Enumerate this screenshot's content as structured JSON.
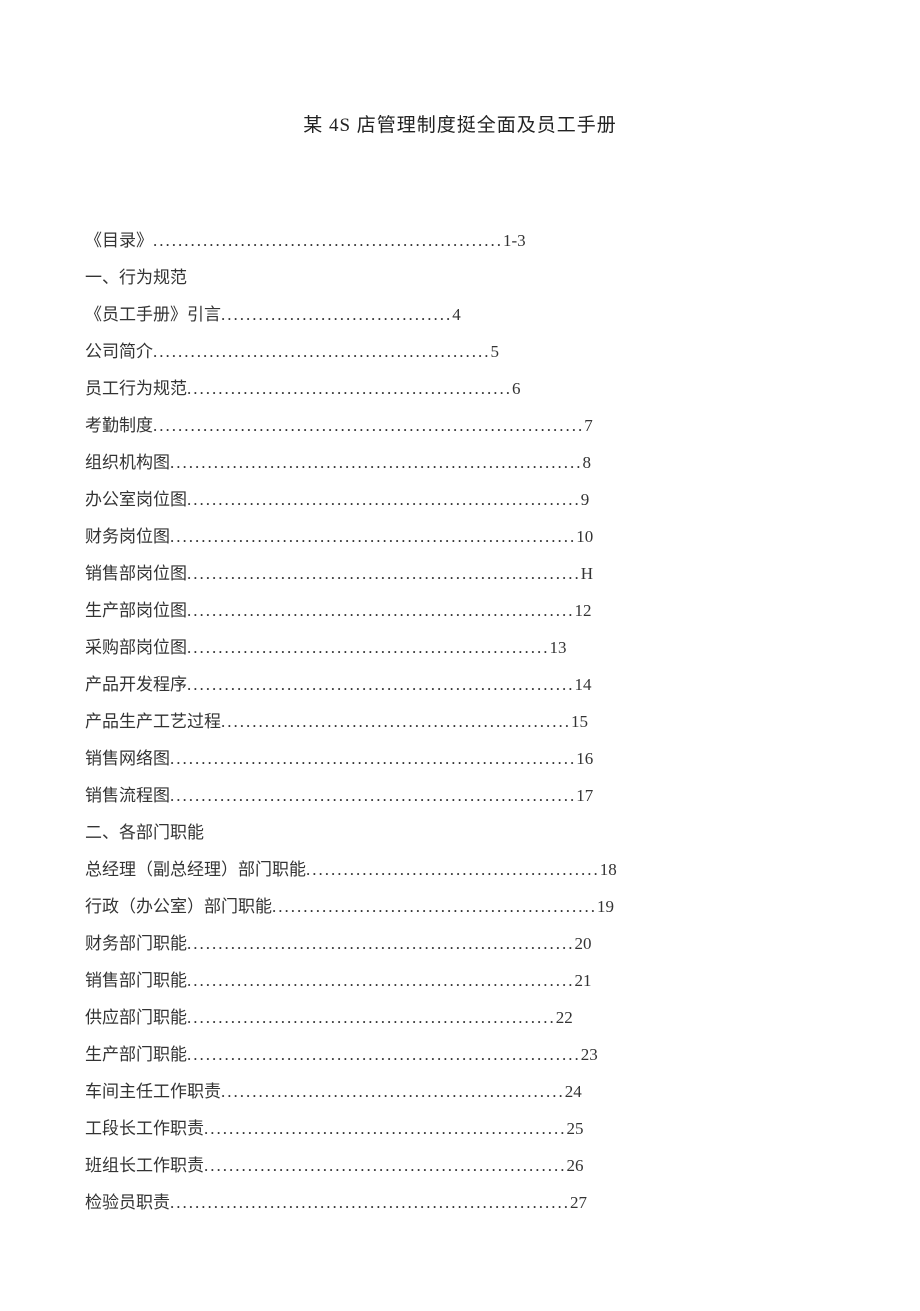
{
  "title": "某 4S 店管理制度挺全面及员工手册",
  "toc": [
    {
      "type": "entry",
      "label": "《目录》",
      "dots": "........................................................",
      "page": "1-3"
    },
    {
      "type": "section",
      "label": "一、行为规范"
    },
    {
      "type": "entry",
      "label": "《员工手册》引言",
      "dots": ".....................................",
      "page": "4"
    },
    {
      "type": "entry",
      "label": "公司简介",
      "dots": "......................................................",
      "page": "5"
    },
    {
      "type": "entry",
      "label": "员工行为规范",
      "dots": "....................................................",
      "page": "6"
    },
    {
      "type": "entry",
      "label": "考勤制度",
      "dots": ".....................................................................",
      "page": "7"
    },
    {
      "type": "entry",
      "label": "组织机构图",
      "dots": "..................................................................",
      "page": "8"
    },
    {
      "type": "entry",
      "label": "办公室岗位图",
      "dots": "...............................................................",
      "page": "9"
    },
    {
      "type": "entry",
      "label": "财务岗位图",
      "dots": ".................................................................",
      "page": "10"
    },
    {
      "type": "entry",
      "label": "销售部岗位图",
      "dots": "...............................................................",
      "page": "H"
    },
    {
      "type": "entry",
      "label": "生产部岗位图",
      "dots": "..............................................................",
      "page": "12"
    },
    {
      "type": "entry",
      "label": "采购部岗位图",
      "dots": "..........................................................",
      "page": "13"
    },
    {
      "type": "entry",
      "label": "产品开发程序",
      "dots": "..............................................................",
      "page": "14"
    },
    {
      "type": "entry",
      "label": "产品生产工艺过程",
      "dots": "........................................................",
      "page": "15"
    },
    {
      "type": "entry",
      "label": "销售网络图",
      "dots": ".................................................................",
      "page": "16"
    },
    {
      "type": "entry",
      "label": "销售流程图",
      "dots": ".................................................................",
      "page": "17"
    },
    {
      "type": "section",
      "label": "二、各部门职能"
    },
    {
      "type": "entry",
      "label": "总经理（副总经理）部门职能",
      "dots": "...............................................",
      "page": "18"
    },
    {
      "type": "entry",
      "label": "行政（办公室）部门职能",
      "dots": "....................................................",
      "page": "19"
    },
    {
      "type": "entry",
      "label": "财务部门职能",
      "dots": "..............................................................",
      "page": "20"
    },
    {
      "type": "entry",
      "label": "销售部门职能",
      "dots": "..............................................................",
      "page": "21"
    },
    {
      "type": "entry",
      "label": "供应部门职能",
      "dots": "...........................................................",
      "page": "22"
    },
    {
      "type": "entry",
      "label": "生产部门职能",
      "dots": "...............................................................",
      "page": "23"
    },
    {
      "type": "entry",
      "label": "车间主任工作职责",
      "dots": ".......................................................",
      "page": "24"
    },
    {
      "type": "entry",
      "label": "工段长工作职责",
      "dots": "..........................................................",
      "page": "25"
    },
    {
      "type": "entry",
      "label": "班组长工作职责",
      "dots": "..........................................................",
      "page": "26"
    },
    {
      "type": "entry",
      "label": "检验员职责",
      "dots": "................................................................",
      "page": "27"
    }
  ]
}
